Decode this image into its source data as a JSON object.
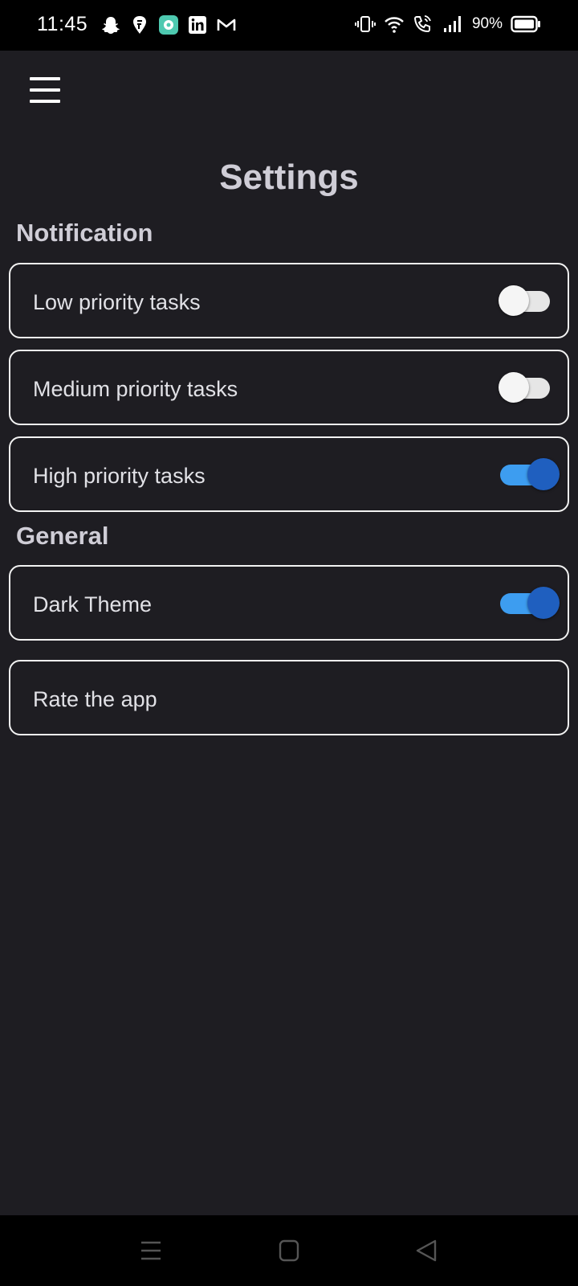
{
  "status_bar": {
    "time": "11:45",
    "battery": "90%",
    "left_icons": [
      "snapchat-icon",
      "swiggy-icon",
      "chat-app-icon",
      "linkedin-icon",
      "gmail-icon"
    ],
    "right_icons": [
      "vibrate-icon",
      "wifi-icon",
      "wifi-calling-icon",
      "signal-icon",
      "battery-icon"
    ]
  },
  "app_bar": {
    "menu_icon": "hamburger-menu-icon"
  },
  "page": {
    "title": "Settings"
  },
  "sections": {
    "notification": {
      "header": "Notification",
      "items": [
        {
          "label": "Low priority tasks",
          "enabled": false
        },
        {
          "label": "Medium priority tasks",
          "enabled": false
        },
        {
          "label": "High priority tasks",
          "enabled": true
        }
      ]
    },
    "general": {
      "header": "General",
      "dark_theme": {
        "label": "Dark Theme",
        "enabled": true
      },
      "rate_app": {
        "label": "Rate the app"
      }
    }
  },
  "nav_bar": {
    "buttons": [
      "recents-icon",
      "home-icon",
      "back-icon"
    ]
  },
  "colors": {
    "background": "#1e1d22",
    "toggle_on_track": "#3d9df0",
    "toggle_on_thumb": "#1f5fbf",
    "row_border": "#f2f2f2"
  }
}
